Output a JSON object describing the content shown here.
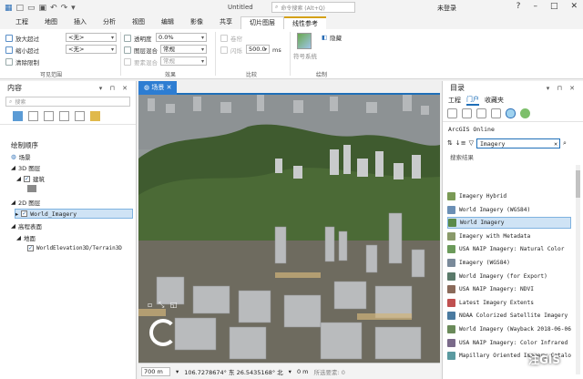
{
  "app": {
    "title": "Untitled",
    "search_placeholder": "命令搜索 (Alt+Q)",
    "user": "未登录"
  },
  "tabs": [
    "工程",
    "地图",
    "插入",
    "分析",
    "视图",
    "编辑",
    "影像",
    "共享",
    "切片图层",
    "线性参考"
  ],
  "ribbon": {
    "zoom_in": "放大超过",
    "zoom_out": "缩小超过",
    "clear_limit": "清除限制",
    "combo1": "<无>",
    "combo2": "<无>",
    "transparency_label": "透明度",
    "transparency_value": "0.0%",
    "blend_label": "图层混合",
    "blend_value": "常规",
    "feature_blend_label": "要素混合",
    "feature_blend_value": "常规",
    "swipe": "卷帘",
    "flicker_label": "闪烁",
    "flicker_value": "500.0",
    "flicker_unit": "ms",
    "symbology": "符号系统",
    "compare_label": "比较",
    "draw_label": "绘制",
    "effect_label": "效果",
    "visible_range_label": "可见范围",
    "hide": "隐藏"
  },
  "contents": {
    "title": "内容",
    "search_placeholder": "搜索",
    "draw_order": "绘制顺序",
    "tree": [
      "场景",
      "3D 图层",
      "建筑",
      "2D 图层",
      "World_Imagery",
      "高程表面",
      "地面",
      "WorldElevation3D/Terrain3D"
    ]
  },
  "scene_tab": "场景",
  "status": {
    "scale": "700 m",
    "coords": "106.7278674° 东 26.5435168° 北",
    "z": "0 m",
    "selected": "所选要素: 0"
  },
  "catalog": {
    "title": "目录",
    "tabs": [
      "工程",
      "门户",
      "收藏夹"
    ],
    "agol": "ArcGIS Online",
    "filter": "Imagery",
    "results_label": "搜索结果",
    "items": [
      "Imagery Hybrid",
      "World Imagery (WGS84)",
      "World Imagery",
      "Imagery with Metadata",
      "USA NAIP Imagery: Natural Color",
      "Imagery (WGS84)",
      "World Imagery (for Export)",
      "USA NAIP Imagery: NDVI",
      "Latest Imagery Extents",
      "NOAA Colorized Satellite Imagery",
      "World Imagery (Wayback 2018-06-06)",
      "USA NAIP Imagery: Color Infrared",
      "Mapillary Oriented Imagery Catalog"
    ],
    "selected_index": 2
  },
  "watermark": "注GIS"
}
